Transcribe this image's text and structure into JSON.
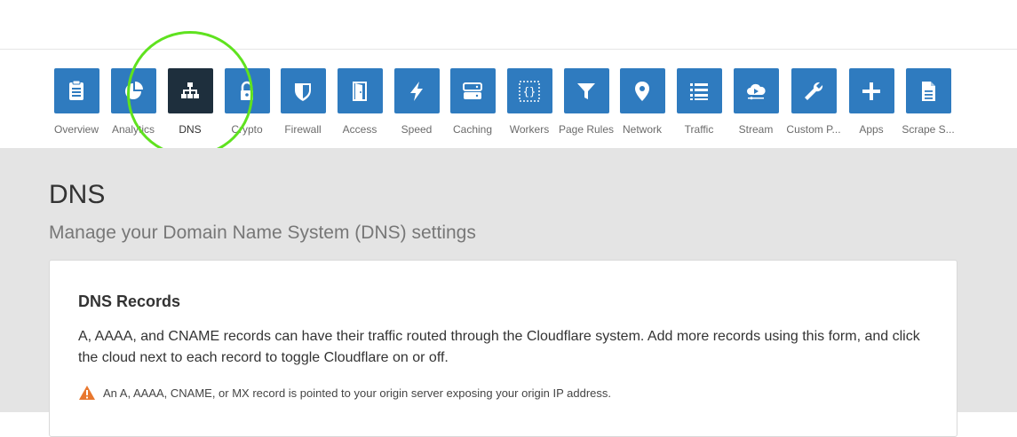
{
  "nav": {
    "items": [
      {
        "label": "Overview",
        "icon": "clipboard-icon"
      },
      {
        "label": "Analytics",
        "icon": "pie-chart-icon"
      },
      {
        "label": "DNS",
        "icon": "network-tree-icon",
        "active": true
      },
      {
        "label": "Crypto",
        "icon": "lock-icon"
      },
      {
        "label": "Firewall",
        "icon": "shield-icon"
      },
      {
        "label": "Access",
        "icon": "door-icon"
      },
      {
        "label": "Speed",
        "icon": "lightning-icon"
      },
      {
        "label": "Caching",
        "icon": "server-icon"
      },
      {
        "label": "Workers",
        "icon": "braces-icon"
      },
      {
        "label": "Page Rules",
        "icon": "filter-icon"
      },
      {
        "label": "Network",
        "icon": "location-pin-icon"
      },
      {
        "label": "Traffic",
        "icon": "list-icon"
      },
      {
        "label": "Stream",
        "icon": "cloud-stream-icon"
      },
      {
        "label": "Custom P...",
        "icon": "wrench-icon"
      },
      {
        "label": "Apps",
        "icon": "plus-icon"
      },
      {
        "label": "Scrape S...",
        "icon": "document-icon"
      }
    ]
  },
  "page": {
    "title": "DNS",
    "subtitle": "Manage your Domain Name System (DNS) settings"
  },
  "card": {
    "title": "DNS Records",
    "description": "A, AAAA, and CNAME records can have their traffic routed through the Cloudflare system. Add more records using this form, and click the cloud next to each record to toggle Cloudflare on or off.",
    "warning": "An A, AAAA, CNAME, or MX record is pointed to your origin server exposing your origin IP address."
  },
  "colors": {
    "tile": "#2f7bbf",
    "tile_active": "#1e2f3d",
    "highlight": "#5fe21f",
    "warning": "#e8772e"
  }
}
